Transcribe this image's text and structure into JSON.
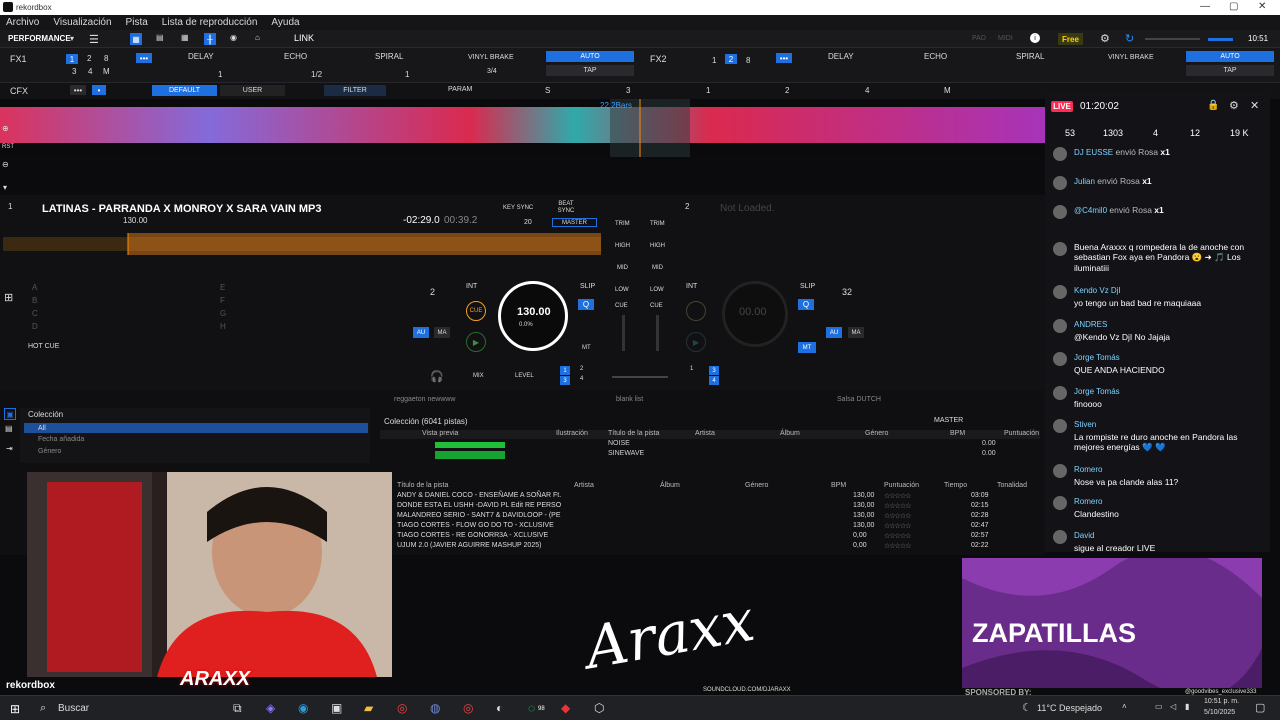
{
  "window": {
    "title": "rekordbox",
    "controls": [
      "—",
      "▢",
      "✕"
    ]
  },
  "menu": [
    "Archivo",
    "Visualización",
    "Pista",
    "Lista de reproducción",
    "Ayuda"
  ],
  "topbar": {
    "mode": "PERFORMANCE",
    "link": "LINK",
    "pad": "PAD",
    "midi": "MIDI",
    "free": "Free",
    "clock": "10:51"
  },
  "fx": {
    "fx1": "FX1",
    "fx2": "FX2",
    "effects": [
      "DELAY",
      "ECHO",
      "SPIRAL"
    ],
    "vinyl": "VINYL BRAKE",
    "auto": "AUTO",
    "tap": "TAP",
    "beat_nums": [
      "1",
      "2",
      "8",
      "3",
      "4",
      "M"
    ],
    "fractions": [
      "1",
      "1/2",
      "1",
      "3/4"
    ]
  },
  "cfx": {
    "label": "CFX",
    "default": "DEFAULT",
    "user": "USER",
    "filter": "FILTER",
    "param": "PARAM",
    "s": "S",
    "nums": [
      "3",
      "1",
      "2",
      "4",
      "M"
    ],
    "bars": "22.2Bars",
    "rst": "RST"
  },
  "deck1": {
    "num": "1",
    "title": "LATINAS - PARRANDA X MONROY X SARA VAIN MP3",
    "bpm": "130.00",
    "time_remain": "-02:29.0",
    "time_elapsed": "00:39.2",
    "key_sync": "KEY SYNC",
    "beat_sync": "BEAT SYNC",
    "master": "MASTER",
    "key": "20",
    "hotcue_letters": [
      "A",
      "B",
      "C",
      "D",
      "E",
      "F",
      "G",
      "H"
    ],
    "hotcue": "HOT CUE",
    "loop": "2",
    "int": "INT",
    "cue": "CUE",
    "jog_bpm": "130.00",
    "pitch": "0.0%",
    "slip": "SLIP",
    "q": "Q",
    "au": "AU",
    "ma": "MA",
    "mt": "MT"
  },
  "deck2": {
    "num": "2",
    "status": "Not Loaded.",
    "jog_bpm": "00.00",
    "loop": "32",
    "int": "INT",
    "slip": "SLIP",
    "q": "Q",
    "au": "AU",
    "ma": "MA",
    "mt": "MT",
    "beat_sync": "BEAT SYNC",
    "master": "MASTER",
    "hotcue": "HOT CUE"
  },
  "mixer": {
    "trim": "TRIM",
    "high": "HIGH",
    "mid": "MID",
    "low": "LOW",
    "cue": "CUE",
    "mix": "MIX",
    "level": "LEVEL",
    "ch": [
      "1",
      "2",
      "3",
      "4"
    ]
  },
  "browser": {
    "tabs": [
      "reggaeton newwww",
      "blank list",
      "Salsa DUTCH"
    ],
    "tree": [
      "Colección",
      "All",
      "Fecha añadida",
      "Género"
    ],
    "collection_count": "Colección (6041 pistas)",
    "master": "MASTER",
    "cols_top": [
      "Vista previa",
      "Ilustración",
      "Título de la pista",
      "Artista",
      "Álbum",
      "Género",
      "BPM",
      "Puntuación"
    ],
    "top_rows": [
      {
        "title": "NOISE",
        "bpm": "0.00"
      },
      {
        "title": "SINEWAVE",
        "bpm": "0.00"
      }
    ],
    "cols": [
      "Título de la pista",
      "Artista",
      "Álbum",
      "Género",
      "BPM",
      "Puntuación",
      "Tiempo",
      "Tonalidad"
    ],
    "rows": [
      {
        "title": "ANDY & DANIEL COCO - ENSEÑAME A SOÑAR Ft.",
        "bpm": "130,00",
        "time": "03:09"
      },
      {
        "title": "DONDE ESTA EL USHH -DAVID PL Edit RE PERSO",
        "bpm": "130,00",
        "time": "02:15"
      },
      {
        "title": "MALANDREO SERIO - SANT7 & DAVIDLOOP - (PE",
        "bpm": "130,00",
        "time": "02:28"
      },
      {
        "title": "TIAGO CORTES - FLOW GO DO TO - XCLUSIVE",
        "bpm": "130,00",
        "time": "02:47"
      },
      {
        "title": "TIAGO CORTES - RE GONORR3A - XCLUSIVE",
        "bpm": "0,00",
        "time": "02:57"
      },
      {
        "title": "UJUM 2.0 (JAVIER AGUIRRE MASHUP 2025)",
        "bpm": "0,00",
        "time": "02:22"
      }
    ]
  },
  "live": {
    "badge": "LIVE",
    "timer": "01:20:02",
    "stats": [
      "53",
      "1303",
      "4",
      "12",
      "19 K"
    ],
    "messages": [
      {
        "name": "DJ EUSSE",
        "text": "envió Rosa",
        "extra": "x1"
      },
      {
        "name": "Julian",
        "text": "envió Rosa",
        "extra": "x1"
      },
      {
        "name": "@C4mil0",
        "text": "envió Rosa",
        "extra": "x1"
      },
      {
        "name": "",
        "text": "Buena Araxxx q rompedera la de anoche con sebastian Fox aya en Pandora 😮 ➜ 🎵 Los iluminatiii",
        "extra": ""
      },
      {
        "name": "Kendo Vz DjI",
        "text": "yo tengo un bad bad re maquiaaa",
        "extra": ""
      },
      {
        "name": "ANDRES",
        "text": "@Kendo Vz DjI No Jajaja",
        "extra": ""
      },
      {
        "name": "Jorge Tomás",
        "text": "QUE ANDA HACIENDO",
        "extra": ""
      },
      {
        "name": "Jorge Tomás",
        "text": "finoooo",
        "extra": ""
      },
      {
        "name": "Stiven",
        "text": "La rompiste re duro anoche en Pandora las mejores energías 💙 💙",
        "extra": ""
      },
      {
        "name": "Romero",
        "text": "Nose va pa clande alas 11?",
        "extra": ""
      },
      {
        "name": "Romero",
        "text": "Clandestino",
        "extra": ""
      },
      {
        "name": "David",
        "text": "sigue al creador LIVE",
        "extra": ""
      }
    ]
  },
  "promo": {
    "text": "ZAPATILLAS",
    "sponsored": "SPONSORED BY:",
    "handle": "@goodvibes_exclusive333"
  },
  "overlay": {
    "signature": "Araxx",
    "soundcloud": "SOUNDCLOUD.COM/DJARAXX",
    "cam_logo": "ARAXX",
    "rekordbox": "rekordbox"
  },
  "taskbar": {
    "search": "Buscar",
    "weather": "11°C Despejado",
    "time": "10:51 p. m.",
    "date": "5/10/2025",
    "badge": "98"
  }
}
